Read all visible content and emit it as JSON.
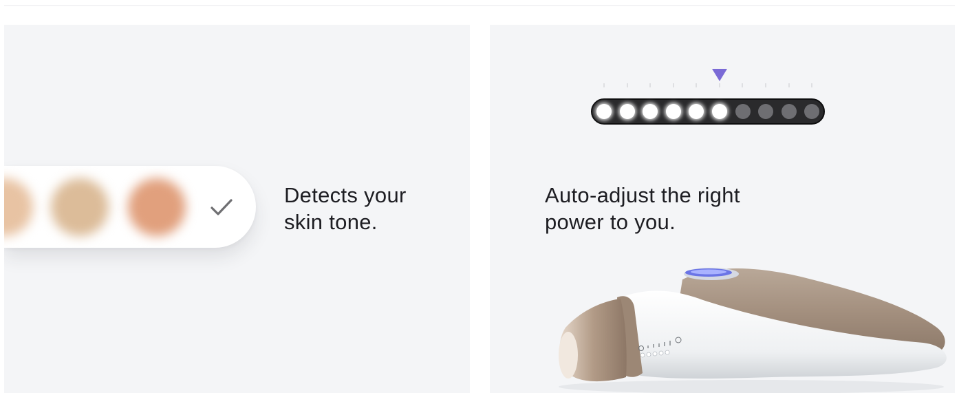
{
  "left_panel": {
    "caption_line1": "Detects your",
    "caption_line2": "skin tone.",
    "swatch_colors": [
      "#e8c3a3",
      "#dcbc99",
      "#e1a07d"
    ],
    "check_icon": "check-icon",
    "check_color": "#6f6f72"
  },
  "right_panel": {
    "caption_line1": "Auto-adjust the right",
    "caption_line2": "power to you.",
    "pointer_color": "#7a6ad6",
    "power_meter": {
      "total_levels": 10,
      "active_levels": 6
    },
    "device_icon": "ipl-device-illustration"
  }
}
